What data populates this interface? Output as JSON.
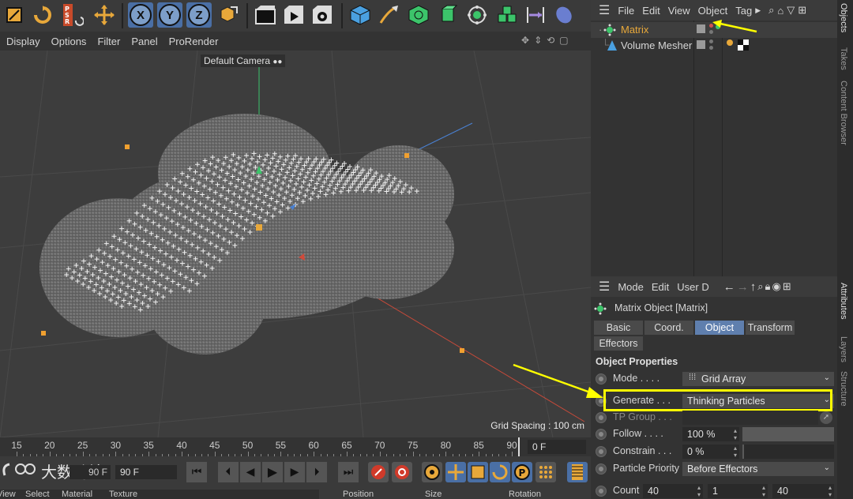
{
  "toolbar": {
    "axis_buttons": [
      "X",
      "Y",
      "Z"
    ]
  },
  "viewport_menu": {
    "items": [
      "Display",
      "Options",
      "Filter",
      "Panel",
      "ProRender"
    ]
  },
  "viewport": {
    "camera_label": "Default Camera",
    "grid_spacing": "Grid Spacing : 100 cm"
  },
  "timeline": {
    "ticks": [
      "15",
      "20",
      "25",
      "30",
      "35",
      "40",
      "45",
      "50",
      "55",
      "60",
      "65",
      "70",
      "75",
      "80",
      "85",
      "90"
    ],
    "current_frame": "0 F",
    "end_frame": "90 F",
    "max_frame": "90 F"
  },
  "bottom_bar": {
    "items": [
      "View",
      "Select",
      "Material",
      "Texture"
    ],
    "coord_headers": [
      "Position",
      "Size",
      "Rotation"
    ]
  },
  "object_manager": {
    "menu": [
      "File",
      "Edit",
      "View",
      "Object",
      "Tag"
    ],
    "objects": [
      {
        "name": "Matrix",
        "color": "#e8a83a"
      },
      {
        "name": "Volume Mesher",
        "color": "#d6d6d6"
      }
    ]
  },
  "side_tabs": [
    "Objects",
    "Takes",
    "Content Browser",
    "Attributes",
    "Layers",
    "Structure"
  ],
  "attributes": {
    "menu": [
      "Mode",
      "Edit",
      "User D"
    ],
    "object_title": "Matrix Object [Matrix]",
    "tabs": [
      "Basic",
      "Coord.",
      "Object",
      "Transform",
      "Effectors"
    ],
    "active_tab": "Object",
    "section_title": "Object Properties",
    "properties": {
      "mode": {
        "label": "Mode . . . .",
        "value": "Grid Array"
      },
      "generate": {
        "label": "Generate . . .",
        "value": "Thinking Particles"
      },
      "tp_group": {
        "label": "TP Group . . ."
      },
      "follow": {
        "label": "Follow . . . .",
        "value": "100 %",
        "fraction": 1.0
      },
      "constrain": {
        "label": "Constrain . . .",
        "value": "0 %",
        "fraction": 0.0
      },
      "particle_priority": {
        "label": "Particle Priority",
        "value": "Before Effectors"
      },
      "count": {
        "label": "Count",
        "values": [
          "40",
          "1",
          "40"
        ]
      }
    }
  },
  "watermark": {
    "text": "大数跨境"
  },
  "colors": {
    "highlight": "#ffff00",
    "active_tab": "#5f7fae",
    "selected_object": "#e8a83a"
  }
}
